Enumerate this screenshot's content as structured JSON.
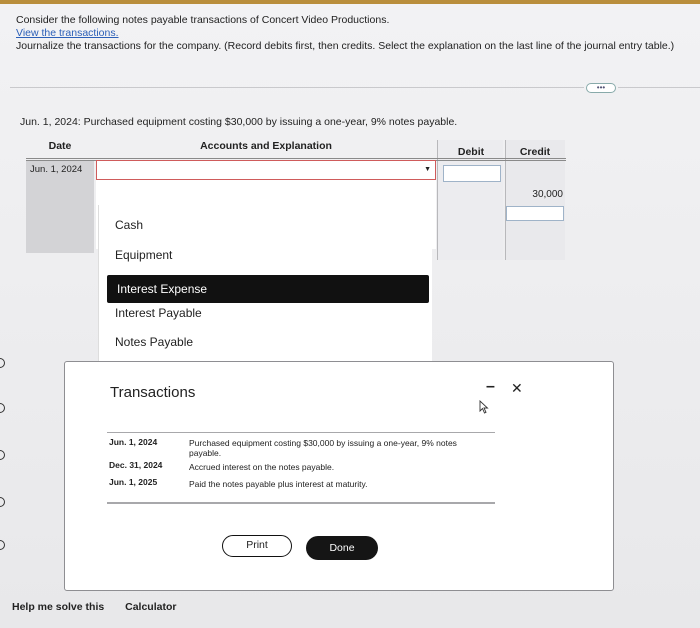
{
  "intro": {
    "line1": "Consider the following notes payable transactions of Concert Video Productions.",
    "link": "View the transactions.",
    "line3": "Journalize the transactions for the company. (Record debits first, then credits. Select the explanation on the last line of the journal entry table.)"
  },
  "problem": "Jun. 1, 2024: Purchased equipment costing $30,000 by issuing a one-year, 9% notes payable.",
  "journal": {
    "headers": {
      "date": "Date",
      "accounts": "Accounts and Explanation",
      "debit": "Debit",
      "credit": "Credit"
    },
    "row_date": "Jun. 1, 2024",
    "credit_value": "30,000"
  },
  "dropdown": {
    "options": [
      "Cash",
      "Equipment",
      "Interest Expense",
      "Interest Payable",
      "Notes Payable"
    ],
    "selected": "Interest Expense"
  },
  "modal": {
    "title": "Transactions",
    "rows": [
      {
        "date": "Jun. 1, 2024",
        "desc": "Purchased equipment costing $30,000 by issuing a one-year, 9% notes payable."
      },
      {
        "date": "Dec. 31, 2024",
        "desc": "Accrued interest on the notes payable."
      },
      {
        "date": "Jun. 1, 2025",
        "desc": "Paid the notes payable plus interest at maturity."
      }
    ],
    "print_label": "Print",
    "done_label": "Done"
  },
  "footer": {
    "help": "Help me solve this",
    "calculator": "Calculator"
  },
  "colors": {
    "accent_bar": "#b98e3c",
    "link": "#2b5fb8",
    "select_border": "#cf5b5b"
  }
}
